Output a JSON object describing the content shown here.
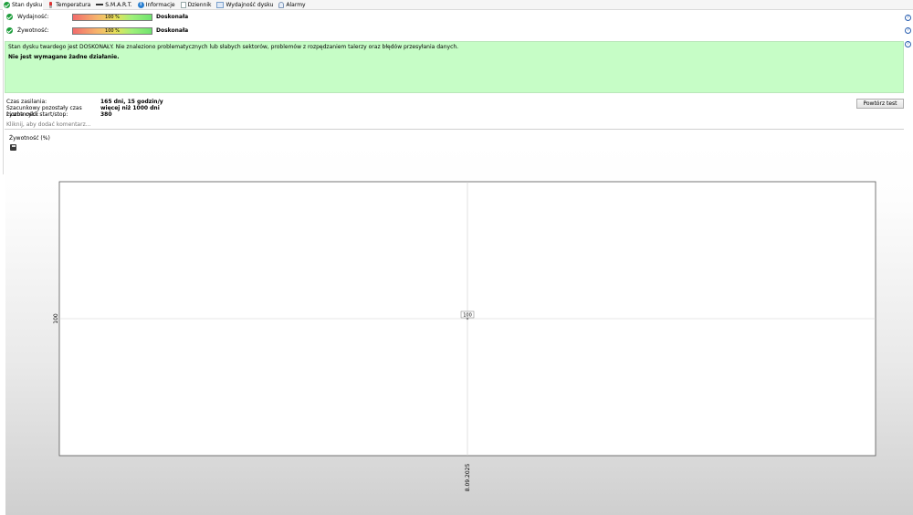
{
  "tabs": [
    {
      "label": "Stan dysku",
      "icon": "check-icon"
    },
    {
      "label": "Temperatura",
      "icon": "thermometer-icon"
    },
    {
      "label": "S.M.A.R.T.",
      "icon": "smart-icon"
    },
    {
      "label": "Informacje",
      "icon": "info-icon"
    },
    {
      "label": "Dziennik",
      "icon": "log-icon"
    },
    {
      "label": "Wydajność dysku",
      "icon": "performance-icon"
    },
    {
      "label": "Alarmy",
      "icon": "alarm-icon"
    }
  ],
  "status": {
    "performance": {
      "label": "Wydajność:",
      "percent": "100 %",
      "value": "Doskonała",
      "fill": 1.0
    },
    "health": {
      "label": "Żywotność:",
      "percent": "100 %",
      "value": "Doskonała",
      "fill": 1.0
    }
  },
  "message": {
    "line1": "Stan dysku twardego jest DOSKONAŁY. Nie znaleziono problematycznych lub słabych sektorów, problemów z rozpędzaniem talerzy oraz błędów przesyłania danych.",
    "line2": "Nie jest wymagane żadne działanie.",
    "bg_color": "#c6fdc6"
  },
  "info": {
    "power_on_label": "Czas zasilania:",
    "power_on_value": "165 dni, 15 godzin/y",
    "remaining_label": "Szacunkowy pozostały czas żywotności:",
    "remaining_value": "więcej niż 1000 dni",
    "cycles_label": "Liczba cykli start/stop:",
    "cycles_value": "380"
  },
  "retest_button": "Powtórz test",
  "comment_placeholder": "Kliknij, aby dodać komentarz...",
  "chart_title": "Żywotność (%)",
  "chart_data": {
    "type": "line",
    "x": [
      "8.09.2025"
    ],
    "series": [
      {
        "values": [
          100
        ]
      }
    ],
    "xlabel": "",
    "ylabel": "",
    "y_tick_labels": [
      "100"
    ],
    "data_labels": [
      "100"
    ],
    "grid": true
  }
}
